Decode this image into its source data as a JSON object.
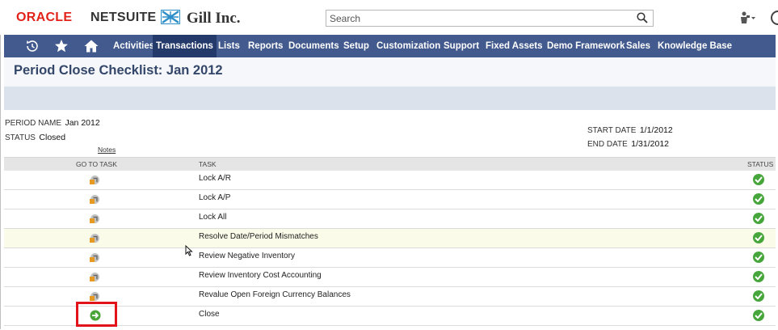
{
  "header": {
    "brand_oracle": "ORACLE",
    "brand_netsuite": "NETSUITE",
    "company_name": "Gill Inc.",
    "search_placeholder": "Search"
  },
  "nav": {
    "items": [
      "Activities",
      "Transactions",
      "Lists",
      "Reports",
      "Documents",
      "Setup",
      "Customization",
      "Support",
      "Fixed Assets",
      "Demo Framework",
      "Sales",
      "Knowledge Base"
    ],
    "active": "Transactions"
  },
  "page": {
    "title": "Period Close Checklist: Jan 2012",
    "period_name_label": "PERIOD NAME",
    "period_name": "Jan 2012",
    "status_label": "STATUS",
    "status": "Closed",
    "notes_link": "Notes",
    "start_date_label": "START DATE",
    "start_date": "1/1/2012",
    "end_date_label": "END DATE",
    "end_date": "1/31/2012"
  },
  "table": {
    "columns": [
      "GO TO TASK",
      "TASK",
      "STATUS"
    ],
    "rows": [
      {
        "task": "Lock A/R",
        "status": "complete"
      },
      {
        "task": "Lock A/P",
        "status": "complete"
      },
      {
        "task": "Lock All",
        "status": "complete"
      },
      {
        "task": "Resolve Date/Period Mismatches",
        "status": "complete"
      },
      {
        "task": "Review Negative Inventory",
        "status": "complete"
      },
      {
        "task": "Review Inventory Cost Accounting",
        "status": "complete"
      },
      {
        "task": "Revalue Open Foreign Currency Balances",
        "status": "complete"
      },
      {
        "task": "Close",
        "status": "complete"
      }
    ]
  },
  "colors": {
    "nav_bg": "#425a8e",
    "nav_active": "#243a6a",
    "title": "#34476a",
    "brand_red": "#e2231a",
    "status_green": "#47a63b",
    "highlight_box": "#e3131b"
  }
}
